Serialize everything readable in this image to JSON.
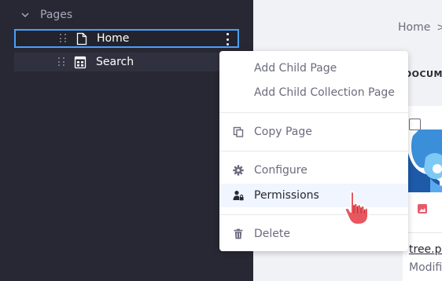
{
  "sidebar": {
    "section_title": "Pages",
    "items": [
      {
        "label": "Home",
        "icon": "page-icon"
      },
      {
        "label": "Search",
        "icon": "collection-page-icon"
      }
    ]
  },
  "breadcrumb": {
    "home_label": "Home",
    "separator": ">"
  },
  "content": {
    "section_label": "DOCUMENTS",
    "card": {
      "file_name": "tree.png",
      "meta": "Modified"
    }
  },
  "context_menu": {
    "items": [
      {
        "label": "Add Child Page",
        "icon": null
      },
      {
        "label": "Add Child Collection Page",
        "icon": null
      },
      {
        "label": "Copy Page",
        "icon": "copy-icon"
      },
      {
        "label": "Configure",
        "icon": "gear-icon"
      },
      {
        "label": "Permissions",
        "icon": "user-lock-icon",
        "active": true
      },
      {
        "label": "Delete",
        "icon": "trash-icon"
      }
    ]
  },
  "colors": {
    "sidebar_bg": "#272833",
    "selection_border": "#4b9fff",
    "menu_active_bg": "#f0f5ff",
    "cursor_fill": "#e8575f"
  }
}
